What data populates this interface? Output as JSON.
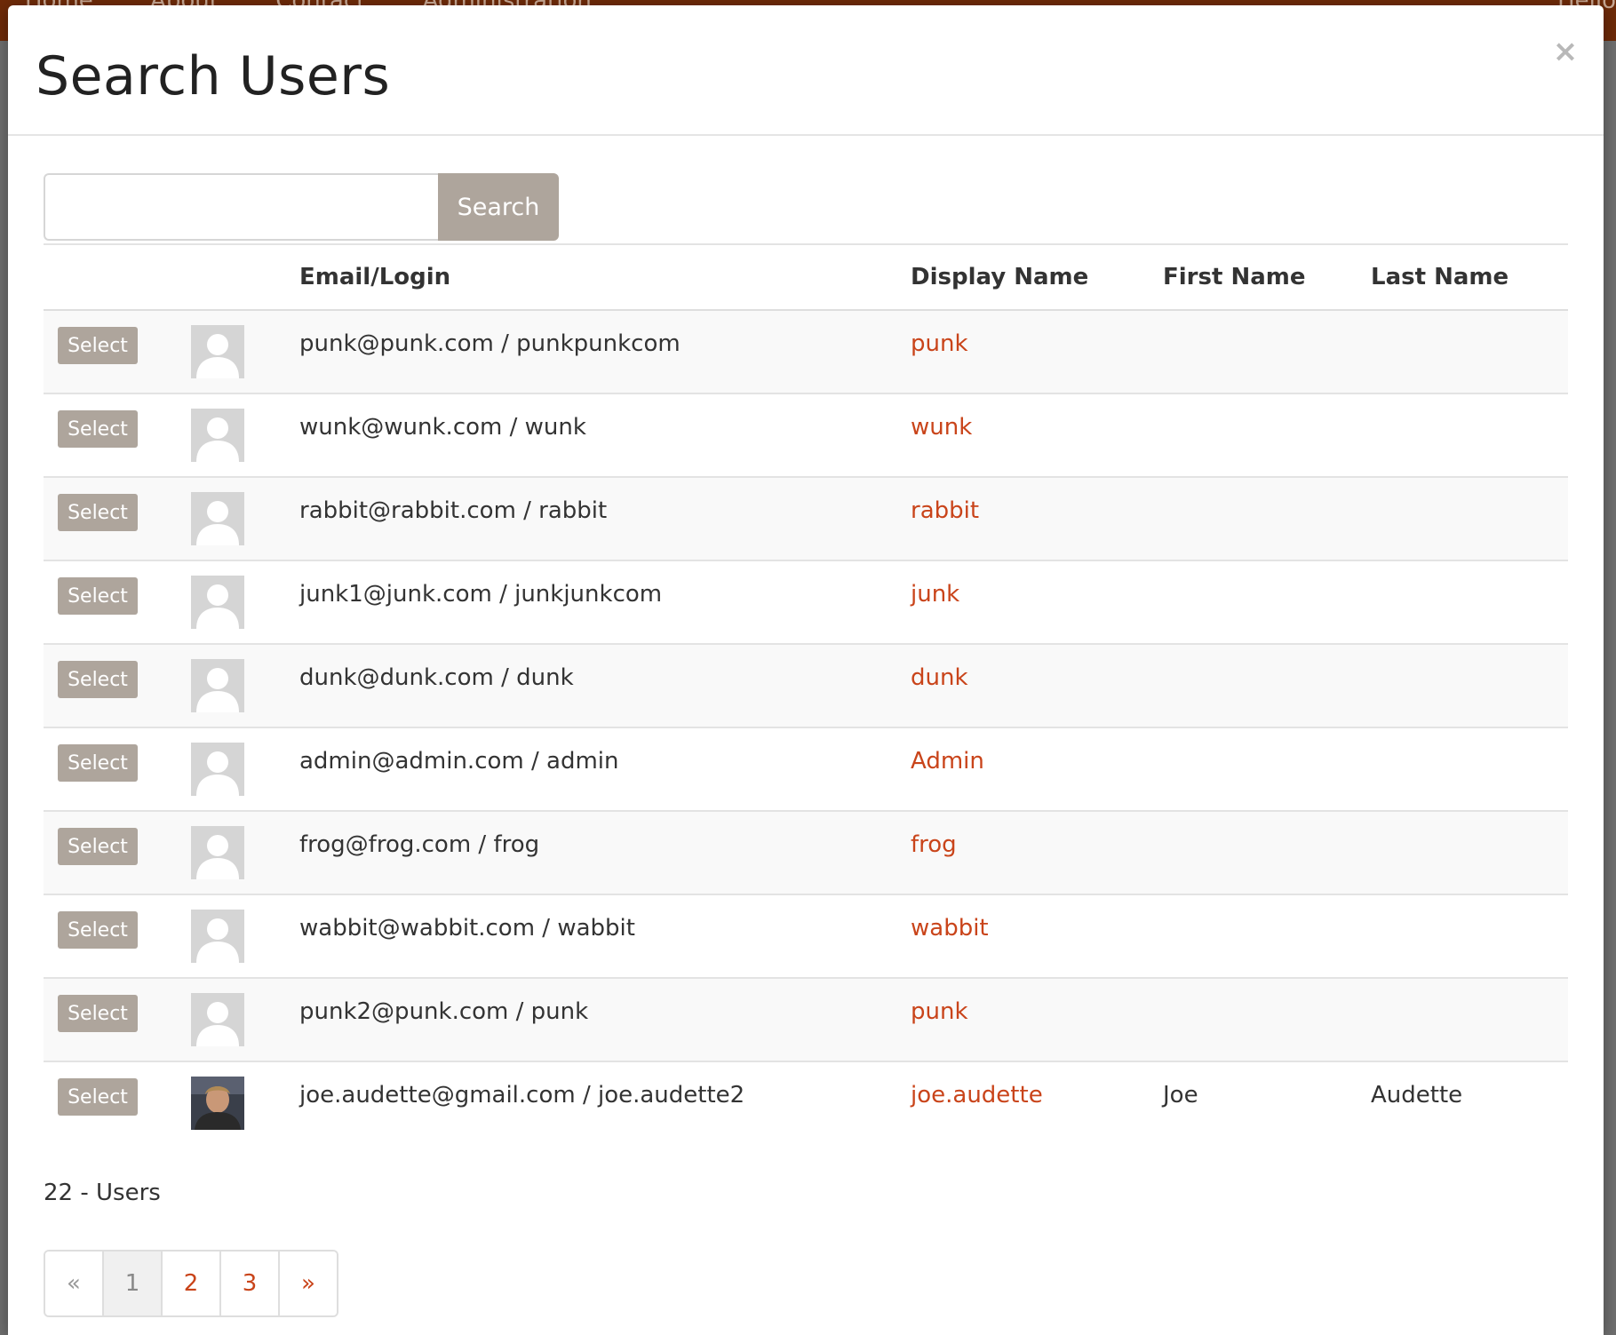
{
  "background": {
    "nav_items": [
      "Home",
      "About",
      "Contact",
      "Administration"
    ],
    "nav_right": "Hello"
  },
  "modal": {
    "title": "Search Users",
    "close_glyph": "×"
  },
  "search": {
    "value": "",
    "placeholder": "",
    "button_label": "Search"
  },
  "table": {
    "headers": {
      "email": "Email/Login",
      "display_name": "Display Name",
      "first_name": "First Name",
      "last_name": "Last Name"
    },
    "select_label": "Select",
    "rows": [
      {
        "email_login": "punk@punk.com / punkpunkcom",
        "display_name": "punk",
        "first_name": "",
        "last_name": "",
        "avatar": "default"
      },
      {
        "email_login": "wunk@wunk.com / wunk",
        "display_name": "wunk",
        "first_name": "",
        "last_name": "",
        "avatar": "default"
      },
      {
        "email_login": "rabbit@rabbit.com / rabbit",
        "display_name": "rabbit",
        "first_name": "",
        "last_name": "",
        "avatar": "default"
      },
      {
        "email_login": "junk1@junk.com / junkjunkcom",
        "display_name": "junk",
        "first_name": "",
        "last_name": "",
        "avatar": "default"
      },
      {
        "email_login": "dunk@dunk.com / dunk",
        "display_name": "dunk",
        "first_name": "",
        "last_name": "",
        "avatar": "default"
      },
      {
        "email_login": "admin@admin.com / admin",
        "display_name": "Admin",
        "first_name": "",
        "last_name": "",
        "avatar": "default"
      },
      {
        "email_login": "frog@frog.com / frog",
        "display_name": "frog",
        "first_name": "",
        "last_name": "",
        "avatar": "default"
      },
      {
        "email_login": "wabbit@wabbit.com / wabbit",
        "display_name": "wabbit",
        "first_name": "",
        "last_name": "",
        "avatar": "default"
      },
      {
        "email_login": "punk2@punk.com / punk",
        "display_name": "punk",
        "first_name": "",
        "last_name": "",
        "avatar": "default"
      },
      {
        "email_login": "joe.audette@gmail.com / joe.audette2",
        "display_name": "joe.audette",
        "first_name": "Joe",
        "last_name": "Audette",
        "avatar": "photo"
      }
    ]
  },
  "user_count": "22 - Users",
  "pagination": {
    "prev": "«",
    "pages": [
      "1",
      "2",
      "3"
    ],
    "active_page": "1",
    "next": "»"
  },
  "colors": {
    "accent": "#c9441a",
    "button_gray": "#aea59c",
    "topbar": "#6e2a08"
  }
}
